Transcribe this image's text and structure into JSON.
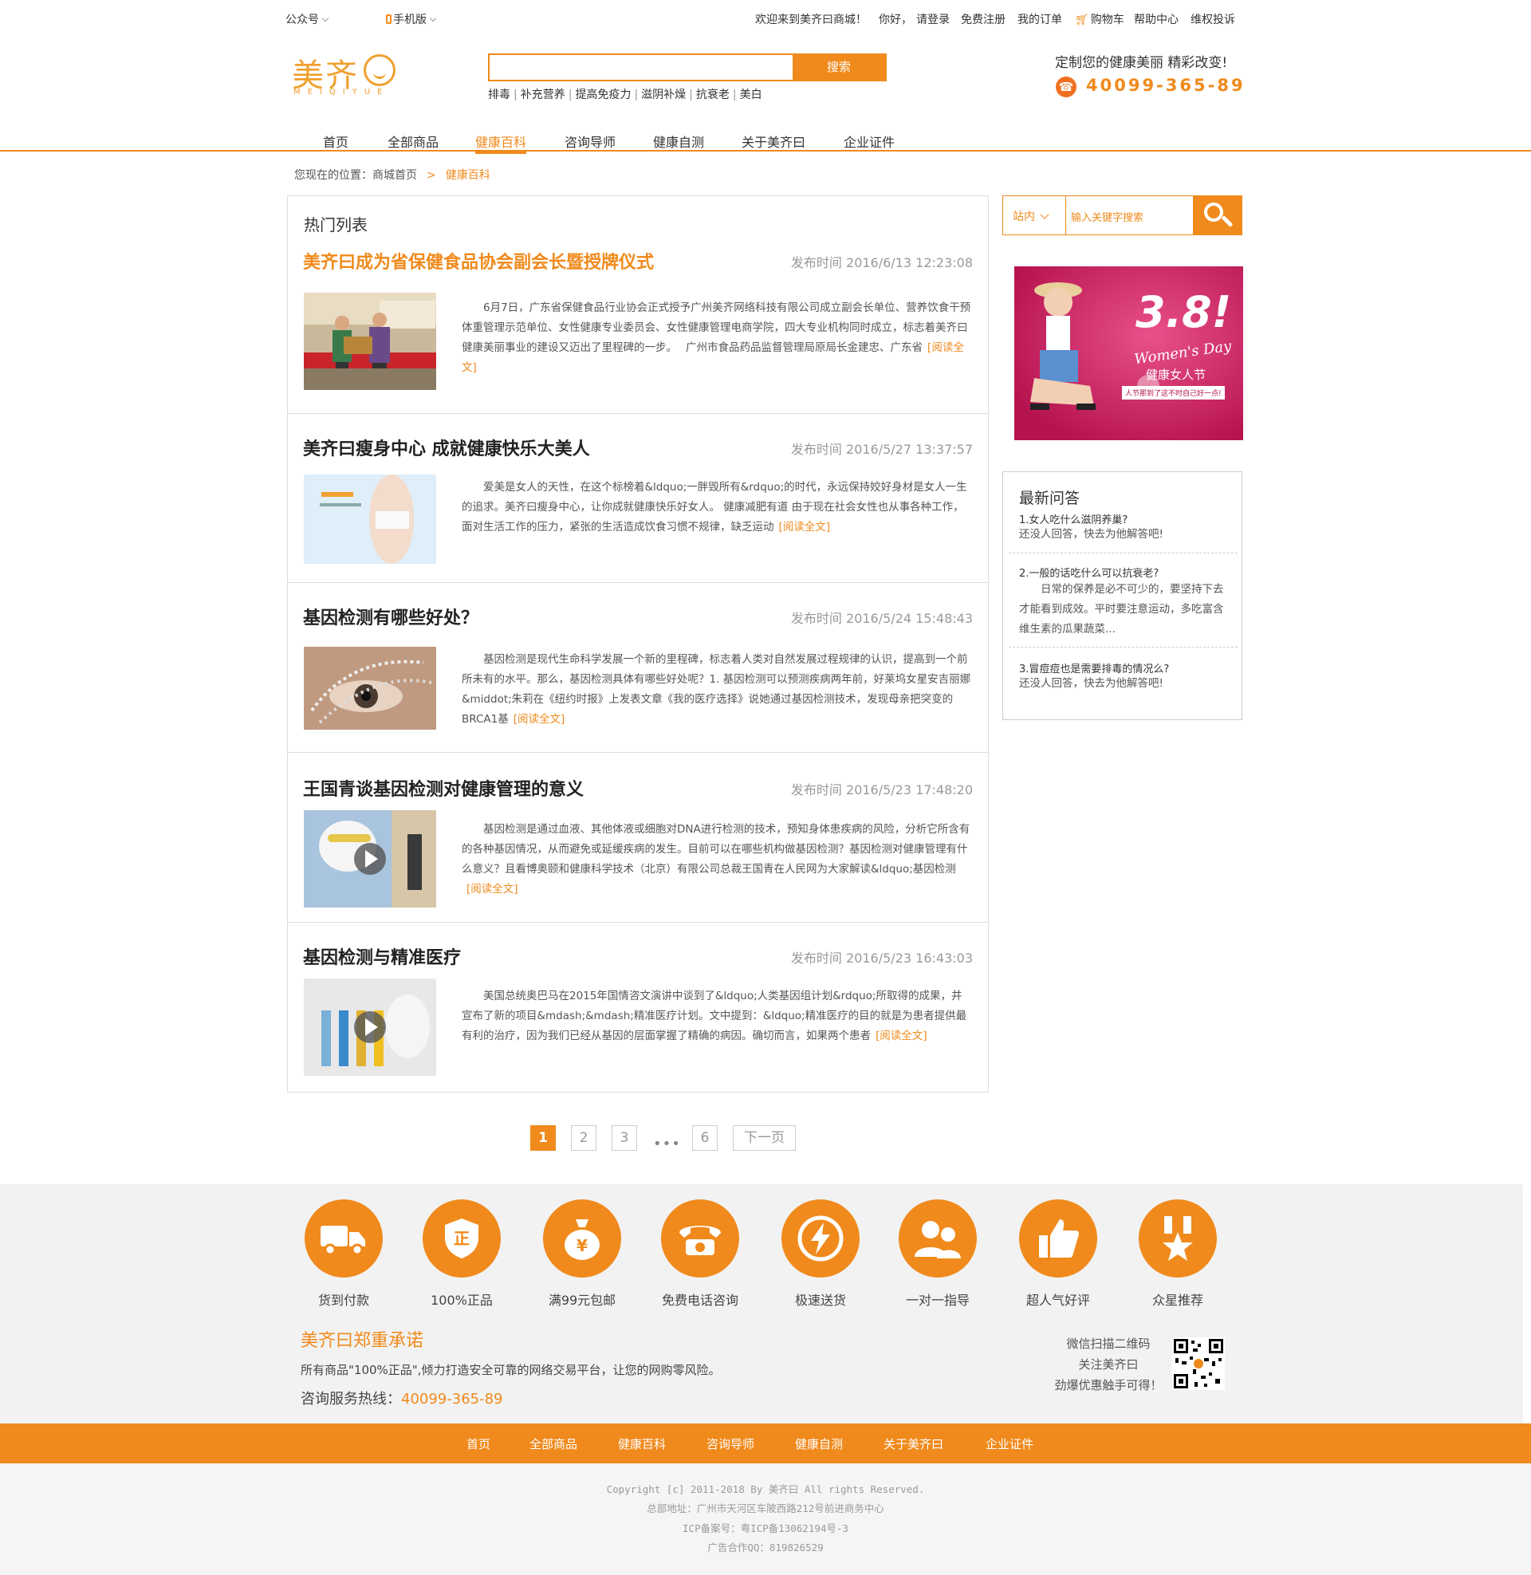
{
  "topbar": {
    "wechat": "公众号",
    "mobile": "手机版",
    "welcome": "欢迎来到美齐曰商城！",
    "hello": "你好，",
    "login": "请登录",
    "register": "免费注册",
    "orders": "我的订单",
    "cart": "购物车",
    "help": "帮助中心",
    "complaint": "维权投诉"
  },
  "header": {
    "logo": "美齐",
    "logo_sub": "MEIQIYUE",
    "search_placeholder": "",
    "search_button": "搜索",
    "hotwords": [
      "排毒",
      "补充营养",
      "提高免疫力",
      "滋阴补燥",
      "抗衰老",
      "美白"
    ],
    "slogan": "定制您的健康美丽 精彩改变!",
    "phone": "40099-365-89"
  },
  "nav": [
    "首页",
    "全部商品",
    "健康百科",
    "咨询导师",
    "健康自测",
    "关于美齐曰",
    "企业证件"
  ],
  "breadcrumb": {
    "prefix": "您现在的位置：商城首页",
    "current": "健康百科"
  },
  "list": {
    "title": "热门列表",
    "read_more": "[阅读全文]",
    "date_prefix": "发布时间",
    "articles": [
      {
        "title": "美齐曰成为省保健食品协会副会长暨授牌仪式",
        "date": "2016/6/13 12:23:08",
        "desc": "6月7日，广东省保健食品行业协会正式授予广州美齐网络科技有限公司成立副会长单位、营养饮食干预体重管理示范单位、女性健康专业委员会、女性健康管理电商学院，四大专业机构同时成立，标志着美齐曰健康美丽事业的建设又迈出了里程碑的一步。　 广州市食品药品监督管理局原局长金建忠、广东省"
      },
      {
        "title": "美齐曰瘦身中心 成就健康快乐大美人",
        "date": "2016/5/27 13:37:57",
        "desc": "爱美是女人的天性，在这个标榜着&ldquo;一胖毁所有&rdquo;的时代，永远保持姣好身材是女人一生的追求。美齐曰瘦身中心，让你成就健康快乐好女人。 健康减肥有道 由于现在社会女性也从事各种工作，面对生活工作的压力，紧张的生活造成饮食习惯不规律，缺乏运动"
      },
      {
        "title": "基因检测有哪些好处？",
        "date": "2016/5/24 15:48:43",
        "desc": "基因检测是现代生命科学发展一个新的里程碑，标志着人类对自然发展过程规律的认识，提高到一个前所未有的水平。那么，基因检测具体有哪些好处呢？1. 基因检测可以预测疾病两年前，好莱坞女星安吉丽娜&middot;朱莉在《纽约时报》上发表文章《我的医疗选择》说她通过基因检测技术，发现母亲把突变的BRCA1基"
      },
      {
        "title": "王国青谈基因检测对健康管理的意义",
        "date": "2016/5/23 17:48:20",
        "desc": "基因检测是通过血液、其他体液或细胞对DNA进行检测的技术，预知身体患疾病的风险，分析它所含有的各种基因情况，从而避免或延缓疾病的发生。目前可以在哪些机构做基因检测？基因检测对健康管理有什么意义？且看博奥颐和健康科学技术（北京）有限公司总裁王国青在人民网为大家解读&ldquo;基因检测"
      },
      {
        "title": "基因检测与精准医疗",
        "date": "2016/5/23 16:43:03",
        "desc": "美国总统奥巴马在2015年国情咨文演讲中谈到了&ldquo;人类基因组计划&rdquo;所取得的成果，并宣布了新的项目&mdash;&mdash;精准医疗计划。文中提到：&ldquo;精准医疗的目的就是为患者提供最有利的治疗，因为我们已经从基因的层面掌握了精确的病因。确切而言，如果两个患者"
      }
    ]
  },
  "pagination": {
    "pages": [
      "1",
      "2",
      "3",
      "6"
    ],
    "ellipsis": "•••",
    "next": "下一页",
    "current": 1
  },
  "sidebar": {
    "scope": "站内",
    "search_placeholder": "输入关键字搜索",
    "banner": {
      "big": "3.8!",
      "event": "Women's Day",
      "cn": "健康女人节",
      "sub": "人节那到了这不时自己好一点!"
    },
    "qa": {
      "title": "最新问答",
      "items": [
        {
          "q": "1.女人吃什么滋阴养巢?",
          "a": "还没人回答，快去为他解答吧!"
        },
        {
          "q": "2.一般的话吃什么可以抗衰老?",
          "a": "日常的保养是必不可少的，要坚持下去才能看到成效。平时要注意运动，多吃富含维生素的瓜果蔬菜..."
        },
        {
          "q": "3.冒痘痘也是需要排毒的情况么?",
          "a": "还没人回答，快去为他解答吧!"
        }
      ]
    }
  },
  "services": [
    {
      "label": "货到付款",
      "icon": "truck-icon"
    },
    {
      "label": "100%正品",
      "icon": "shield-icon"
    },
    {
      "label": "满99元包邮",
      "icon": "money-bag-icon"
    },
    {
      "label": "免费电话咨询",
      "icon": "telephone-icon"
    },
    {
      "label": "极速送货",
      "icon": "lightning-icon"
    },
    {
      "label": "一对一指导",
      "icon": "people-icon"
    },
    {
      "label": "超人气好评",
      "icon": "thumbs-up-icon"
    },
    {
      "label": "众星推荐",
      "icon": "star-medal-icon"
    }
  ],
  "promise": {
    "title": "美齐曰郑重承诺",
    "text": "所有商品\"100%正品\",倾力打造安全可靠的网络交易平台，让您的网购零风险。",
    "hotline_label": "咨询服务热线：",
    "hotline": "40099-365-89",
    "qr_lines": [
      "微信扫描二维码",
      "关注美齐曰",
      "劲爆优惠触手可得！"
    ]
  },
  "footer_nav": [
    "首页",
    "全部商品",
    "健康百科",
    "咨询导师",
    "健康自测",
    "关于美齐曰",
    "企业证件"
  ],
  "copyright": {
    "line1": "Copyright [c] 2011-2018 By 美齐曰 All rights Reserved.",
    "line2": "总部地址：广州市天河区车陂西路212号前进商务中心",
    "line3": "ICP备案号：粤ICP备13062194号-3",
    "line4": "广告合作QQ：819826529"
  },
  "colors": {
    "accent": "#f08a1c"
  }
}
